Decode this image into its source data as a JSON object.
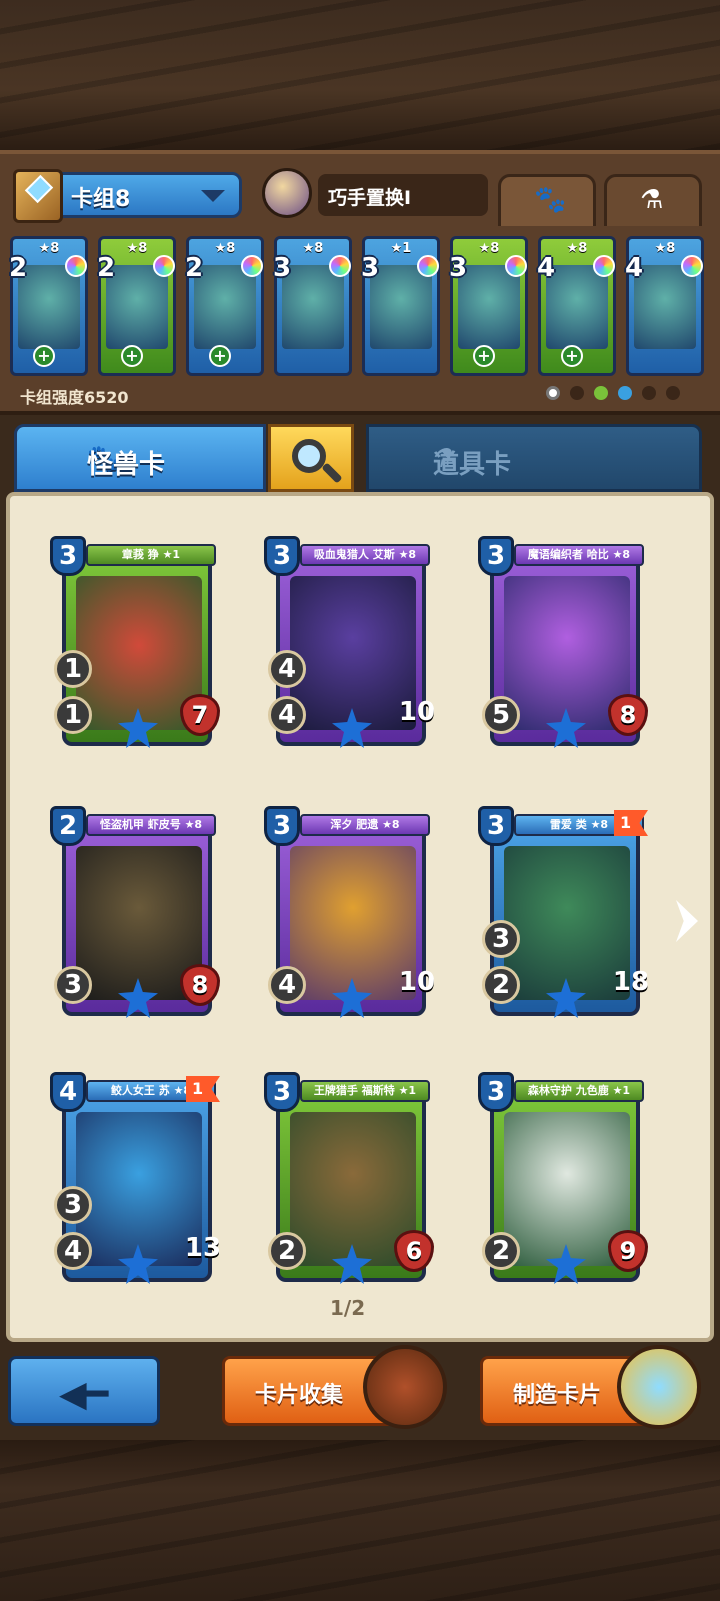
{
  "deck": {
    "name": "卡组8",
    "swap_label": "巧手置换I",
    "strength": "卡组强度6520"
  },
  "deck_cards": [
    {
      "cost": "2",
      "stars": "★8",
      "color": "blue"
    },
    {
      "cost": "2",
      "stars": "★8",
      "color": "green"
    },
    {
      "cost": "2",
      "stars": "★8",
      "color": "blue"
    },
    {
      "cost": "3",
      "stars": "★8",
      "color": "blue"
    },
    {
      "cost": "3",
      "stars": "★1",
      "color": "blue"
    },
    {
      "cost": "3",
      "stars": "★8",
      "color": "green"
    },
    {
      "cost": "4",
      "stars": "★8",
      "color": "green"
    },
    {
      "cost": "4",
      "stars": "★8",
      "color": "blue"
    }
  ],
  "tabs": {
    "monster": "怪兽卡",
    "item": "道具卡"
  },
  "cards": [
    {
      "name": "章莪 狰 ★1",
      "cost": "3",
      "atk": "1",
      "hp": "7",
      "extra": "1",
      "color": "green"
    },
    {
      "name": "吸血鬼猎人 艾斯 ★8",
      "cost": "3",
      "atk": "4",
      "hp": "10",
      "extra": "4",
      "color": "purple"
    },
    {
      "name": "魔语编织者 哈比 ★8",
      "cost": "3",
      "atk": "5",
      "hp": "8",
      "extra": "",
      "color": "purple"
    },
    {
      "name": "怪盗机甲 虾皮号 ★8",
      "cost": "2",
      "atk": "3",
      "hp": "8",
      "extra": "",
      "color": "purple"
    },
    {
      "name": "浑夕 肥遗 ★8",
      "cost": "3",
      "atk": "4",
      "hp": "10",
      "extra": "",
      "color": "purple"
    },
    {
      "name": "雷爱 类 ★8",
      "cost": "3",
      "atk": "2",
      "hp": "18",
      "extra": "3",
      "color": "blue",
      "flag": "1"
    },
    {
      "name": "鲛人女王 苏 ★8",
      "cost": "4",
      "atk": "4",
      "hp": "13",
      "extra": "3",
      "color": "blue",
      "flag": "1"
    },
    {
      "name": "王牌猎手 福斯特 ★1",
      "cost": "3",
      "atk": "2",
      "hp": "6",
      "extra": "",
      "color": "green"
    },
    {
      "name": "森林守护 九色鹿 ★1",
      "cost": "3",
      "atk": "2",
      "hp": "9",
      "extra": "",
      "color": "green"
    }
  ],
  "pager": "1/2",
  "buttons": {
    "collect": "卡片收集",
    "make": "制造卡片"
  }
}
